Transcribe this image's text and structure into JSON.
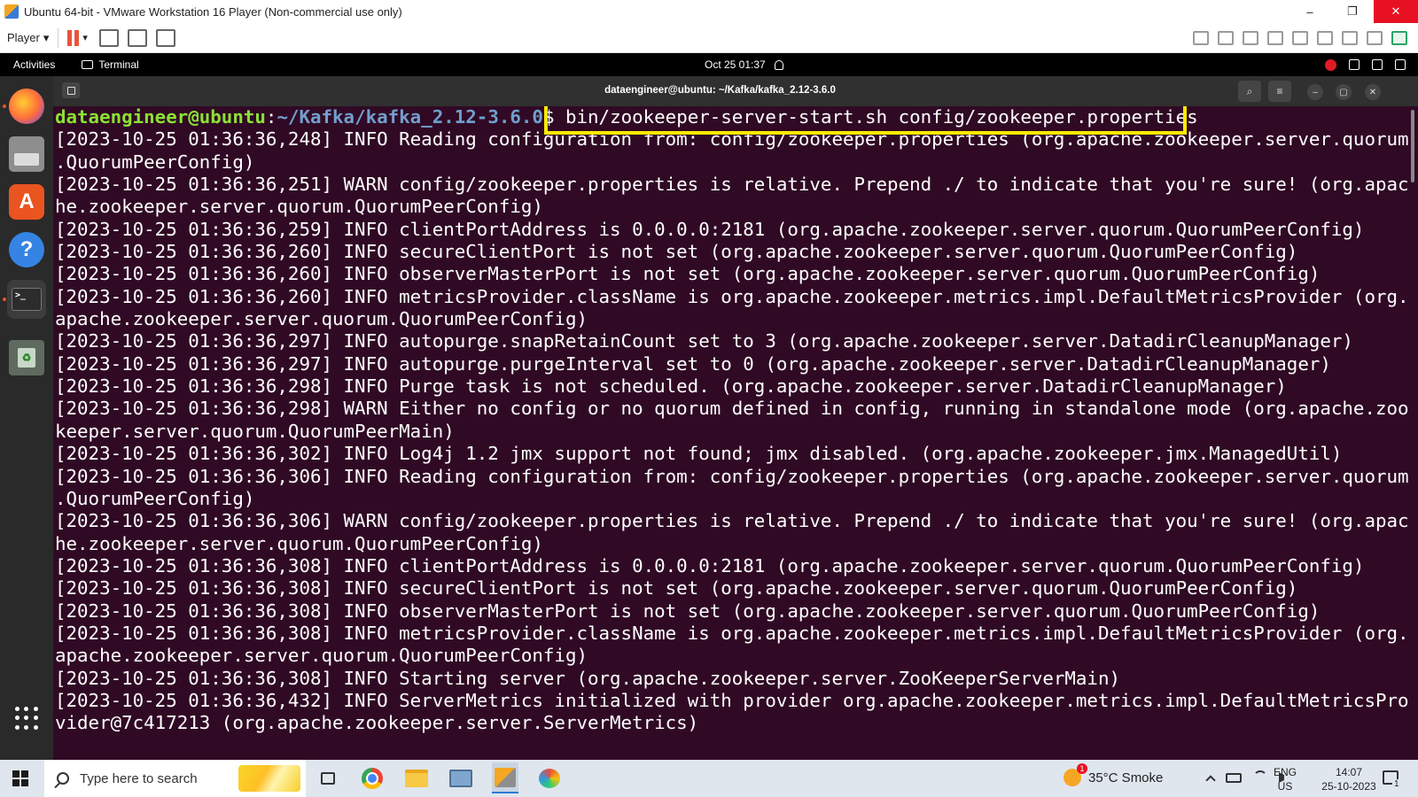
{
  "vmware": {
    "title": "Ubuntu 64-bit - VMware Workstation 16 Player (Non-commercial use only)",
    "player_menu": "Player",
    "dropdown_glyph": "▾",
    "window_controls": {
      "minimize": "–",
      "restore": "❐",
      "close": "✕"
    }
  },
  "gnome_topbar": {
    "activities": "Activities",
    "app_name": "Terminal",
    "clock": "Oct 25  01:37"
  },
  "dock": {
    "software_glyph": "A",
    "help_glyph": "?",
    "terminal_glyph": ">_",
    "trash_glyph": "♻"
  },
  "terminal": {
    "title": "dataengineer@ubuntu: ~/Kafka/kafka_2.12-3.6.0",
    "header_buttons": {
      "search": "⌕",
      "menu": "≡",
      "minimize": "–",
      "maximize": "▢",
      "close": "✕"
    },
    "prompt_user": "dataengineer@ubuntu",
    "prompt_sep": ":",
    "prompt_path": "~/Kafka/kafka_2.12-3.6.0",
    "prompt_dollar": "$ ",
    "command": "bin/zookeeper-server-start.sh config/zookeeper.properties",
    "lines": [
      "[2023-10-25 01:36:36,248] INFO Reading configuration from: config/zookeeper.properties (org.apache.zookeeper.server.quorum",
      ".QuorumPeerConfig)",
      "[2023-10-25 01:36:36,251] WARN config/zookeeper.properties is relative. Prepend ./ to indicate that you're sure! (org.apac",
      "he.zookeeper.server.quorum.QuorumPeerConfig)",
      "[2023-10-25 01:36:36,259] INFO clientPortAddress is 0.0.0.0:2181 (org.apache.zookeeper.server.quorum.QuorumPeerConfig)",
      "[2023-10-25 01:36:36,260] INFO secureClientPort is not set (org.apache.zookeeper.server.quorum.QuorumPeerConfig)",
      "[2023-10-25 01:36:36,260] INFO observerMasterPort is not set (org.apache.zookeeper.server.quorum.QuorumPeerConfig)",
      "[2023-10-25 01:36:36,260] INFO metricsProvider.className is org.apache.zookeeper.metrics.impl.DefaultMetricsProvider (org.",
      "apache.zookeeper.server.quorum.QuorumPeerConfig)",
      "[2023-10-25 01:36:36,297] INFO autopurge.snapRetainCount set to 3 (org.apache.zookeeper.server.DatadirCleanupManager)",
      "[2023-10-25 01:36:36,297] INFO autopurge.purgeInterval set to 0 (org.apache.zookeeper.server.DatadirCleanupManager)",
      "[2023-10-25 01:36:36,298] INFO Purge task is not scheduled. (org.apache.zookeeper.server.DatadirCleanupManager)",
      "[2023-10-25 01:36:36,298] WARN Either no config or no quorum defined in config, running in standalone mode (org.apache.zoo",
      "keeper.server.quorum.QuorumPeerMain)",
      "[2023-10-25 01:36:36,302] INFO Log4j 1.2 jmx support not found; jmx disabled. (org.apache.zookeeper.jmx.ManagedUtil)",
      "[2023-10-25 01:36:36,306] INFO Reading configuration from: config/zookeeper.properties (org.apache.zookeeper.server.quorum",
      ".QuorumPeerConfig)",
      "[2023-10-25 01:36:36,306] WARN config/zookeeper.properties is relative. Prepend ./ to indicate that you're sure! (org.apac",
      "he.zookeeper.server.quorum.QuorumPeerConfig)",
      "[2023-10-25 01:36:36,308] INFO clientPortAddress is 0.0.0.0:2181 (org.apache.zookeeper.server.quorum.QuorumPeerConfig)",
      "[2023-10-25 01:36:36,308] INFO secureClientPort is not set (org.apache.zookeeper.server.quorum.QuorumPeerConfig)",
      "[2023-10-25 01:36:36,308] INFO observerMasterPort is not set (org.apache.zookeeper.server.quorum.QuorumPeerConfig)",
      "[2023-10-25 01:36:36,308] INFO metricsProvider.className is org.apache.zookeeper.metrics.impl.DefaultMetricsProvider (org.",
      "apache.zookeeper.server.quorum.QuorumPeerConfig)",
      "[2023-10-25 01:36:36,308] INFO Starting server (org.apache.zookeeper.server.ZooKeeperServerMain)",
      "[2023-10-25 01:36:36,432] INFO ServerMetrics initialized with provider org.apache.zookeeper.metrics.impl.DefaultMetricsPro",
      "vider@7c417213 (org.apache.zookeeper.server.ServerMetrics)"
    ],
    "highlight_color": "#ffea00"
  },
  "taskbar": {
    "search_placeholder": "Type here to search",
    "weather": "35°C  Smoke",
    "lang_line1": "ENG",
    "lang_line2": "US",
    "time": "14:07",
    "date": "25-10-2023",
    "notification_count": "1"
  },
  "colors": {
    "terminal_bg": "#300a24",
    "prompt_user": "#8ae234",
    "prompt_path": "#729fcf",
    "ubuntu_orange": "#e95420",
    "close_red": "#e81123"
  }
}
